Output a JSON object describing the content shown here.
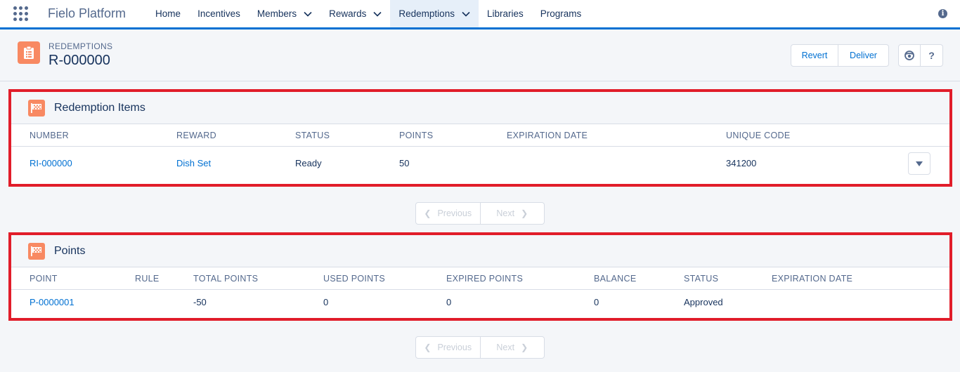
{
  "app": {
    "name": "Fielo Platform"
  },
  "nav": {
    "items": [
      {
        "label": "Home",
        "has_menu": false
      },
      {
        "label": "Incentives",
        "has_menu": false
      },
      {
        "label": "Members",
        "has_menu": true
      },
      {
        "label": "Rewards",
        "has_menu": true
      },
      {
        "label": "Redemptions",
        "has_menu": true,
        "active": true
      },
      {
        "label": "Libraries",
        "has_menu": false
      },
      {
        "label": "Programs",
        "has_menu": false
      }
    ]
  },
  "header": {
    "eyebrow": "REDEMPTIONS",
    "title": "R-000000",
    "buttons": {
      "revert": "Revert",
      "deliver": "Deliver",
      "help": "?"
    }
  },
  "redemption_items": {
    "title": "Redemption Items",
    "columns": [
      "NUMBER",
      "REWARD",
      "STATUS",
      "POINTS",
      "EXPIRATION DATE",
      "UNIQUE CODE"
    ],
    "rows": [
      {
        "number": "RI-000000",
        "reward": "Dish Set",
        "status": "Ready",
        "points": "50",
        "expiration": "",
        "code": "341200"
      }
    ]
  },
  "points": {
    "title": "Points",
    "columns": [
      "POINT",
      "RULE",
      "TOTAL POINTS",
      "USED POINTS",
      "EXPIRED POINTS",
      "BALANCE",
      "STATUS",
      "EXPIRATION DATE"
    ],
    "rows": [
      {
        "point": "P-0000001",
        "rule": "",
        "total": "-50",
        "used": "0",
        "expired": "0",
        "balance": "0",
        "status": "Approved",
        "expiration": ""
      }
    ]
  },
  "pager": {
    "previous": "Previous",
    "next": "Next"
  },
  "colors": {
    "brand": "#0070d2",
    "icon_orange": "#f88962",
    "highlight_red": "#e11d2a"
  }
}
